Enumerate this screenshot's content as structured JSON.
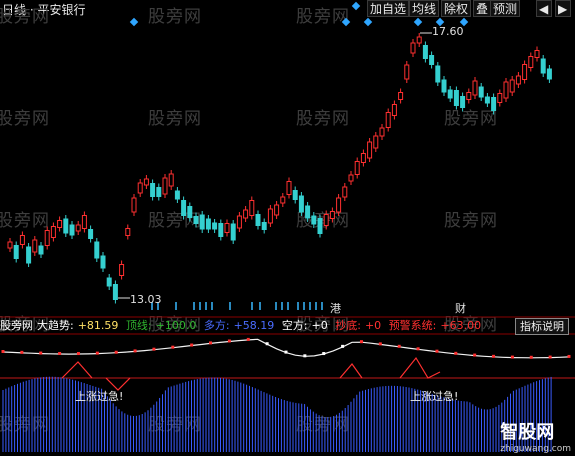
{
  "toolbar": {
    "title": "日线 · 平安银行",
    "buttons": [
      "加自选",
      "均线",
      "除权",
      "叠",
      "预测"
    ],
    "window_icons": [
      "chevron-left-icon",
      "chevron-right-icon"
    ]
  },
  "watermark": "股旁网",
  "price_labels": {
    "high": "17.60",
    "low": "13.03"
  },
  "event_letters": {
    "left": "港",
    "right": "财"
  },
  "indicator": {
    "name": "股旁网",
    "items": [
      {
        "label": "大趋势:",
        "value": "+81.59",
        "color": "#ffffff"
      },
      {
        "label": "顶线:",
        "value": "+100.0",
        "color": "#2fb52f"
      },
      {
        "label": "多方:",
        "value": "+58.19",
        "color": "#4a6cff"
      },
      {
        "label": "空方:",
        "value": "+0",
        "color": "#ffffff"
      },
      {
        "label": "抄底:",
        "value": "+0",
        "color": "#ff3030"
      },
      {
        "label": "预警系统:",
        "value": "+63.00",
        "color": "#ff3030"
      }
    ],
    "help_button": "指标说明"
  },
  "notes": [
    "上涨过急!",
    "上涨过急!"
  ],
  "logo": {
    "name": "智股网",
    "url": "zhiguwang.com"
  },
  "colors": {
    "up": "#ff3030",
    "down": "#35d0d0",
    "marker": "#2fa6ff",
    "volume": "#3a5cff"
  },
  "chart_data": {
    "type": "candlestick",
    "y_marks": {
      "high": 17.6,
      "low": 13.03
    },
    "candles_ohlc_shape": "drawn from script series",
    "indicator_lines": [
      "大趋势",
      "顶线",
      "多方",
      "空方",
      "抄底",
      "预警系统"
    ]
  }
}
